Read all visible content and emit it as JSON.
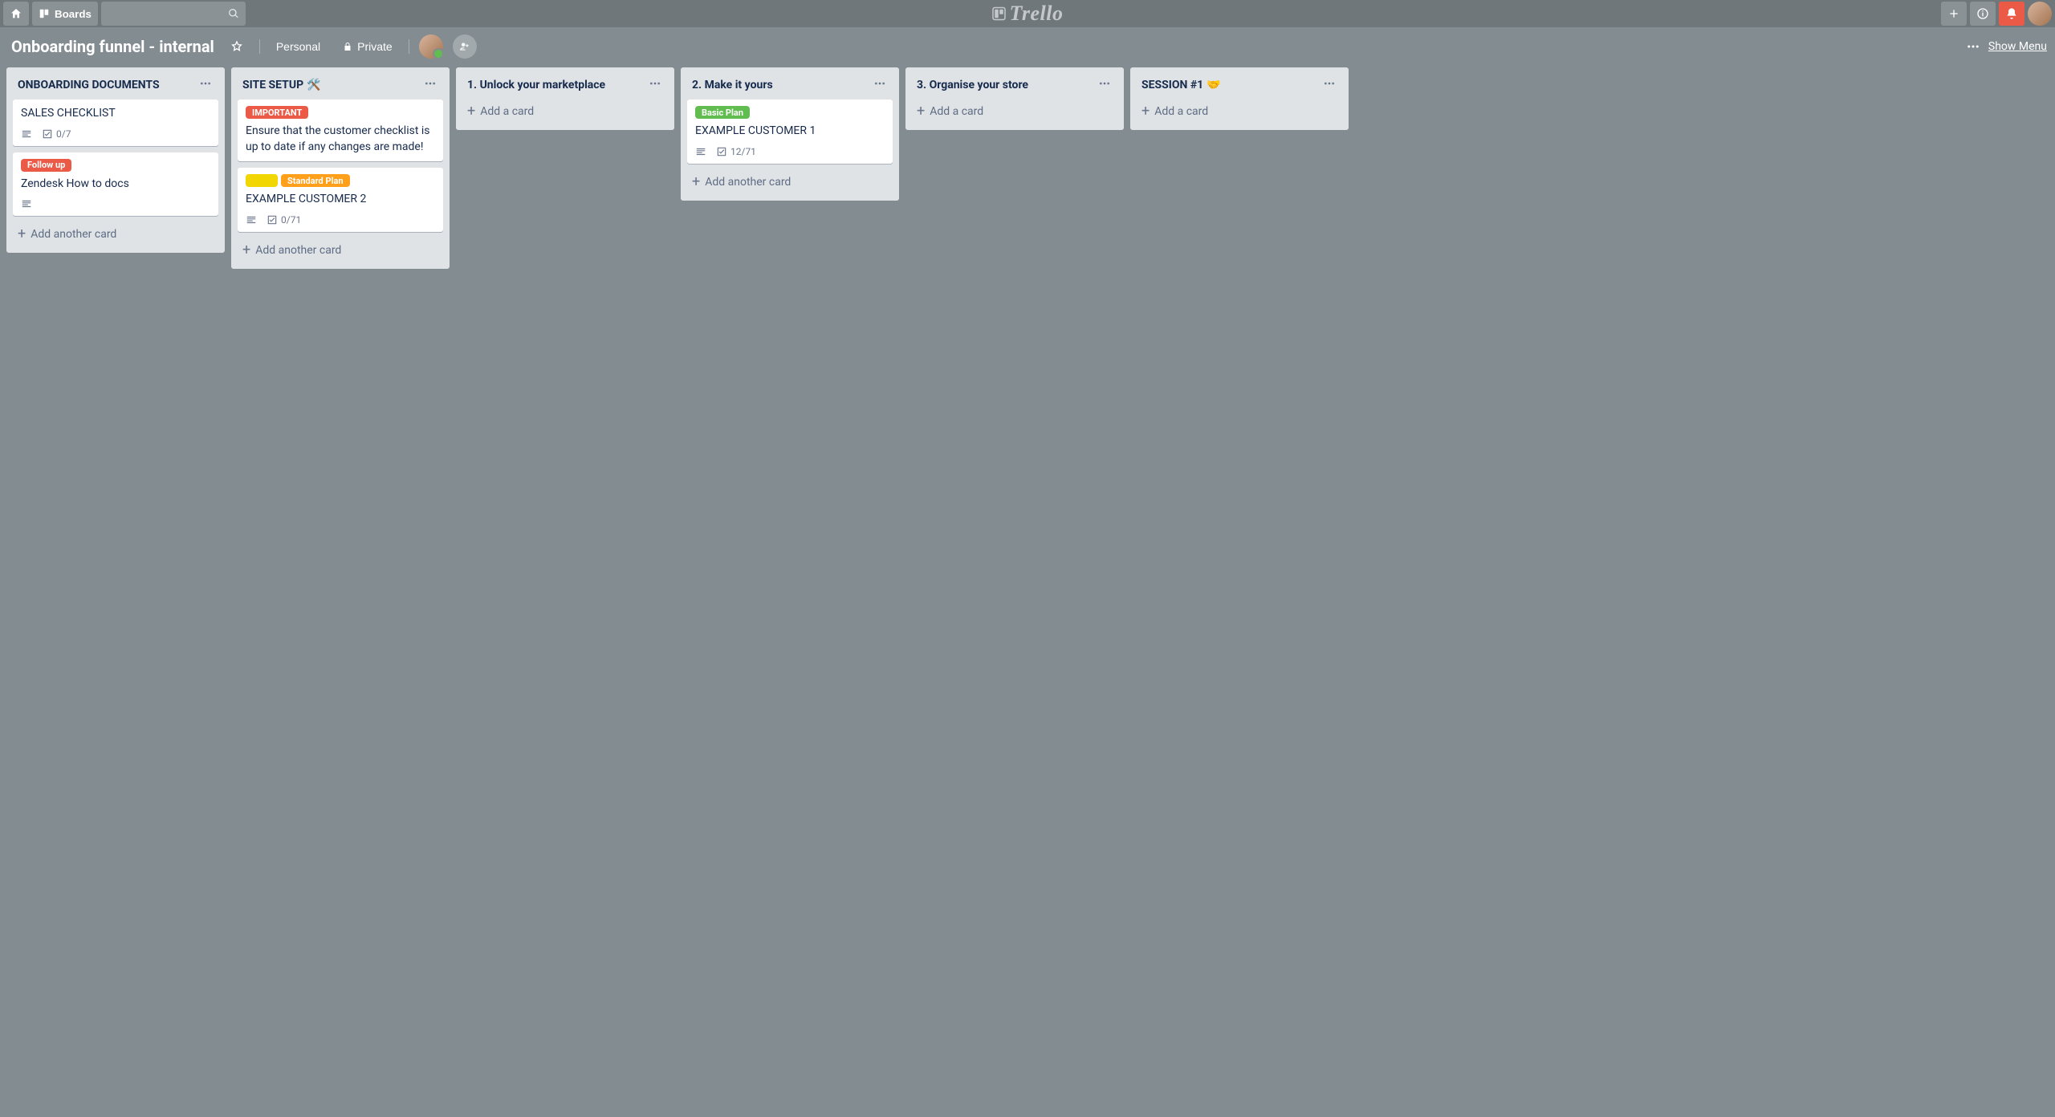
{
  "header": {
    "boards_button": "Boards",
    "logo_text": "Trello"
  },
  "board_header": {
    "title": "Onboarding funnel - internal",
    "team": "Personal",
    "visibility": "Private",
    "show_menu": "Show Menu"
  },
  "label_colors": {
    "red": "#eb5a46",
    "yellow": "#f2d600",
    "green": "#61bd4f",
    "orange": "#ff9f1a"
  },
  "add_card_text": "Add a card",
  "add_another_card_text": "Add another card",
  "lists": [
    {
      "title": "ONBOARDING DOCUMENTS",
      "title_emoji": "",
      "add_mode": "another",
      "cards": [
        {
          "labels": [],
          "title": "SALES CHECKLIST",
          "has_description": true,
          "checklist": "0/7"
        },
        {
          "labels": [
            {
              "color": "red",
              "text": "Follow up"
            }
          ],
          "title": "Zendesk How to docs",
          "has_description": true,
          "checklist": ""
        }
      ]
    },
    {
      "title": "SITE SETUP",
      "title_emoji": "🛠️",
      "add_mode": "another",
      "cards": [
        {
          "labels": [
            {
              "color": "red",
              "text": "IMPORTANT"
            }
          ],
          "title": "Ensure that the customer checklist is up to date if any changes are made!",
          "has_description": false,
          "checklist": ""
        },
        {
          "labels": [
            {
              "color": "yellow",
              "text": ""
            },
            {
              "color": "orange",
              "text": "Standard Plan"
            }
          ],
          "title": "EXAMPLE CUSTOMER 2",
          "has_description": true,
          "checklist": "0/71"
        }
      ]
    },
    {
      "title": "1. Unlock your marketplace",
      "title_emoji": "",
      "add_mode": "card",
      "cards": []
    },
    {
      "title": "2. Make it yours",
      "title_emoji": "",
      "add_mode": "another",
      "cards": [
        {
          "labels": [
            {
              "color": "green",
              "text": "Basic Plan"
            }
          ],
          "title": "EXAMPLE CUSTOMER 1",
          "has_description": true,
          "checklist": "12/71"
        }
      ]
    },
    {
      "title": "3. Organise your store",
      "title_emoji": "",
      "add_mode": "card",
      "cards": []
    },
    {
      "title": "SESSION #1",
      "title_emoji": "🤝",
      "add_mode": "card",
      "cards": []
    }
  ]
}
